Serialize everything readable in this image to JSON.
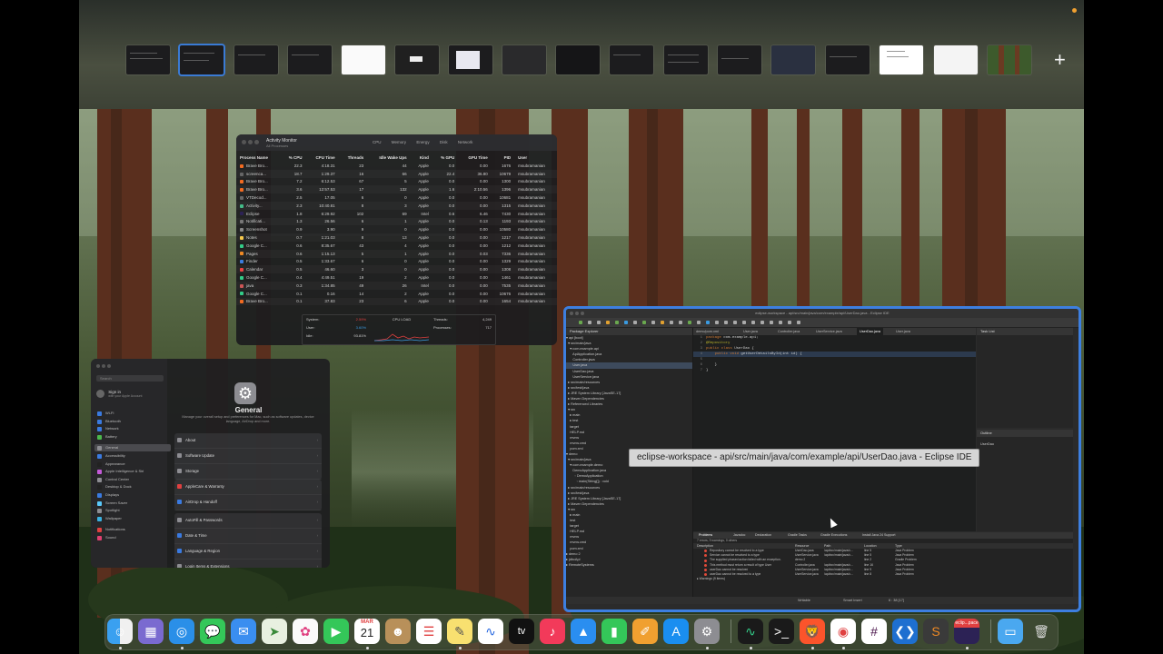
{
  "mission_control": {
    "add_space_label": "+",
    "spaces_count": 17
  },
  "activity_monitor": {
    "title": "Activity Monitor",
    "subtitle": "All Processes",
    "tabs": [
      "CPU",
      "Memory",
      "Energy",
      "Disk",
      "Network"
    ],
    "columns": [
      "Process Name",
      "% CPU",
      "CPU Time",
      "Threads",
      "Idle Wake Ups",
      "Kind",
      "% GPU",
      "GPU Time",
      "PID",
      "User"
    ],
    "rows": [
      [
        "Brave Bro...",
        "22.3",
        "4:18.31",
        "23",
        "44",
        "Apple",
        "0.0",
        "0.00",
        "1676",
        "msubramanian"
      ],
      [
        "screenca...",
        "18.7",
        "1:29.37",
        "16",
        "66",
        "Apple",
        "22.4",
        "36.80",
        "10679",
        "msubramanian"
      ],
      [
        "Brave Bro...",
        "7.2",
        "6:12.53",
        "67",
        "5",
        "Apple",
        "0.0",
        "0.00",
        "1300",
        "msubramanian"
      ],
      [
        "Brave Bro...",
        "3.6",
        "12:57.53",
        "17",
        "132",
        "Apple",
        "1.6",
        "2:10.56",
        "1396",
        "msubramanian"
      ],
      [
        "VTDecod...",
        "2.5",
        "17.05",
        "6",
        "0",
        "Apple",
        "0.0",
        "0.00",
        "10681",
        "msubramanian"
      ],
      [
        "Activity...",
        "2.3",
        "10:40.81",
        "8",
        "3",
        "Apple",
        "0.0",
        "0.00",
        "1315",
        "msubramanian"
      ],
      [
        "Eclipse",
        "1.8",
        "6:29.92",
        "102",
        "69",
        "Intel",
        "0.6",
        "6.46",
        "7430",
        "msubramanian"
      ],
      [
        "Notificati...",
        "1.3",
        "26.56",
        "6",
        "1",
        "Apple",
        "0.0",
        "0.13",
        "1193",
        "msubramanian"
      ],
      [
        "Screenshot",
        "0.9",
        "3.90",
        "9",
        "0",
        "Apple",
        "0.0",
        "0.00",
        "10580",
        "msubramanian"
      ],
      [
        "Notes",
        "0.7",
        "1:21.03",
        "8",
        "13",
        "Apple",
        "0.0",
        "0.00",
        "1217",
        "msubramanian"
      ],
      [
        "Google C...",
        "0.6",
        "8:35.67",
        "43",
        "4",
        "Apple",
        "0.0",
        "0.00",
        "1212",
        "msubramanian"
      ],
      [
        "Pages",
        "0.6",
        "1:15.13",
        "5",
        "1",
        "Apple",
        "0.0",
        "0.03",
        "7336",
        "msubramanian"
      ],
      [
        "Finder",
        "0.5",
        "1:33.67",
        "6",
        "0",
        "Apple",
        "0.0",
        "0.00",
        "1329",
        "msubramanian"
      ],
      [
        "Calendar",
        "0.5",
        "46.60",
        "3",
        "0",
        "Apple",
        "0.0",
        "0.00",
        "1308",
        "msubramanian"
      ],
      [
        "Google C...",
        "0.4",
        "4:49.51",
        "19",
        "2",
        "Apple",
        "0.0",
        "0.00",
        "1461",
        "msubramanian"
      ],
      [
        "java",
        "0.3",
        "1:34.85",
        "49",
        "26",
        "Intel",
        "0.0",
        "0.00",
        "7535",
        "msubramanian"
      ],
      [
        "Google C...",
        "0.1",
        "0.16",
        "14",
        "2",
        "Apple",
        "0.0",
        "0.00",
        "10676",
        "msubramanian"
      ],
      [
        "Brave Bro...",
        "0.1",
        "37.83",
        "23",
        "6",
        "Apple",
        "0.0",
        "0.00",
        "1654",
        "msubramanian"
      ]
    ],
    "icon_colors": [
      "#f26b21",
      "#666",
      "#f26b21",
      "#f26b21",
      "#666",
      "#4b8",
      "#2c2255",
      "#777",
      "#888",
      "#f5c84c",
      "#3c8",
      "#f08a24",
      "#3b7de0",
      "#e44",
      "#3c8",
      "#c55",
      "#3c8",
      "#f26b21"
    ],
    "stats": {
      "system_label": "System:",
      "system_value": "2.59%",
      "user_label": "User:",
      "user_value": "3.60%",
      "idle_label": "Idle:",
      "idle_value": "93.81%",
      "cpu_load_label": "CPU LOAD",
      "threads_label": "Threads:",
      "threads_value": "4,249",
      "processes_label": "Processes:",
      "processes_value": "717"
    }
  },
  "system_settings": {
    "search_placeholder": "Search",
    "sign_in_title": "Sign in",
    "sign_in_sub": "with your Apple Account",
    "sidebar": [
      "Wi-Fi",
      "Bluetooth",
      "Network",
      "Battery",
      "General",
      "Accessibility",
      "Appearance",
      "Apple Intelligence & Siri",
      "Control Center",
      "Desktop & Dock",
      "Displays",
      "Screen Saver",
      "Spotlight",
      "Wallpaper",
      "Notifications",
      "Sound"
    ],
    "sidebar_colors": [
      "#3a7ae0",
      "#3a7ae0",
      "#3a7ae0",
      "#4cb84c",
      "#8d8d92",
      "#3a7ae0",
      "#222",
      "#c45ad8",
      "#8d8d92",
      "#222",
      "#3a7ae0",
      "#5ac8fa",
      "#8d8d92",
      "#3ab0e0",
      "#e04040",
      "#e04070"
    ],
    "selected_index": 4,
    "general_title": "General",
    "general_desc": "Manage your overall setup and preferences for Mac, such as software updates, device language, AirDrop and more.",
    "groups": [
      [
        {
          "label": "About",
          "color": "#8d8d92"
        },
        {
          "label": "Software Update",
          "color": "#8d8d92"
        },
        {
          "label": "Storage",
          "color": "#8d8d92"
        }
      ],
      [
        {
          "label": "AppleCare & Warranty",
          "color": "#e04040"
        },
        {
          "label": "AirDrop & Handoff",
          "color": "#3a7ae0"
        }
      ],
      [
        {
          "label": "AutoFill & Passwords",
          "color": "#8d8d92"
        },
        {
          "label": "Date & Time",
          "color": "#3a7ae0"
        },
        {
          "label": "Language & Region",
          "color": "#3a7ae0"
        },
        {
          "label": "Login Items & Extensions",
          "color": "#8d8d92"
        }
      ]
    ]
  },
  "eclipse": {
    "title": "eclipse-workspace - api/src/main/java/com/example/api/UserDao.java - Eclipse IDE",
    "package_explorer": "Package Explorer",
    "task_list": "Task List",
    "outline": "Outline",
    "tree": [
      "▾ api [boot]",
      "  ▾ src/main/java",
      "    ▾ com.example.api",
      "       ApiApplication.java",
      "       Controller.java",
      "       User.java",
      "       UserDao.java",
      "       UserService.java",
      "  ▸ src/main/resources",
      "  ▸ src/test/java",
      "  ▸ JRE System Library [JavaSE-17]",
      "  ▸ Maven Dependencies",
      "  ▸ Referenced Libraries",
      "  ▾ src",
      "    ▸ main",
      "    ▸ test",
      "    target",
      "    HELP.md",
      "    mvnw",
      "    mvnw.cmd",
      "    pom.xml",
      "▾ demo",
      "  ▾ src/main/java",
      "    ▾ com.example.demo",
      "       DemoApplication.java",
      "         ◦ DemoApplication",
      "           ◦ main(String[]) : void",
      "  ▸ src/main/resources",
      "  ▸ src/test/java",
      "  ▸ JRE System Library [JavaSE-17]",
      "  ▸ Maven Dependencies",
      "  ▾ src",
      "    ▸ main",
      "    test",
      "    target",
      "    HELP.md",
      "    mvnw",
      "    mvnw.cmd",
      "    pom.xml",
      "▸ demo 2",
      "▸ jdbcApi",
      "▸ RemoteSystems"
    ],
    "selected_tree_index": 5,
    "editor_tabs": [
      "demo/pom.xml",
      "User.java",
      "Controller.java",
      "UserService.java",
      "UserDao.java",
      "User.java"
    ],
    "active_tab_index": 4,
    "code": [
      {
        "n": "1",
        "a": "package",
        "b": " com.example.api;"
      },
      {
        "n": "2",
        "a": "",
        "b": "@Repository"
      },
      {
        "n": "3",
        "a": "public class",
        "b": " UserDao {"
      },
      {
        "n": "4",
        "a": "    public void",
        "b": " getUserDetailsById(int id) {"
      },
      {
        "n": "5",
        "a": "",
        "b": ""
      },
      {
        "n": "6",
        "a": "",
        "b": "    }"
      },
      {
        "n": "7",
        "a": "",
        "b": "}"
      }
    ],
    "outline_item": "UserDao",
    "problems": {
      "tabs": [
        "Problems",
        "Javadoc",
        "Declaration",
        "Gradle Tasks",
        "Gradle Executions",
        "Install Java 24 Support"
      ],
      "summary": "7 errors, 9 warnings, 0 others",
      "columns": [
        "Description",
        "Resource",
        "Path",
        "Location",
        "Type"
      ],
      "rows": [
        [
          "Repository cannot be resolved to a type",
          "UserDao.java",
          "/api/src/main/java/c...",
          "line 5",
          "Java Problem"
        ],
        [
          "Service cannot be resolved to a type",
          "UserService.java",
          "/api/src/main/java/c...",
          "line 5",
          "Java Problem"
        ],
        [
          "The supplied phased action failed with an exception.",
          "demo 2",
          "",
          "line 2",
          "Gradle Problem"
        ],
        [
          "This method must return a result of type User",
          "Controller.java",
          "/api/src/main/java/c...",
          "line 16",
          "Java Problem"
        ],
        [
          "userDao cannot be resolved",
          "UserService.java",
          "/api/src/main/java/c...",
          "line 9",
          "Java Problem"
        ],
        [
          "userDao cannot be resolved to a type",
          "UserService.java",
          "/api/src/main/java/c...",
          "line 8",
          "Java Problem"
        ]
      ],
      "warnings_row": "▸ Warnings (9 items)"
    },
    "status": {
      "writable": "Writable",
      "insert": "Smart Insert",
      "position": "6 : 38 [17]"
    }
  },
  "tooltip": "eclipse-workspace - api/src/main/java/com/example/api/UserDao.java - Eclipse IDE",
  "dock": {
    "calendar_month": "MAR",
    "calendar_day": "21",
    "tv_label": "tv",
    "eclipse_label": "eclip...pace"
  }
}
